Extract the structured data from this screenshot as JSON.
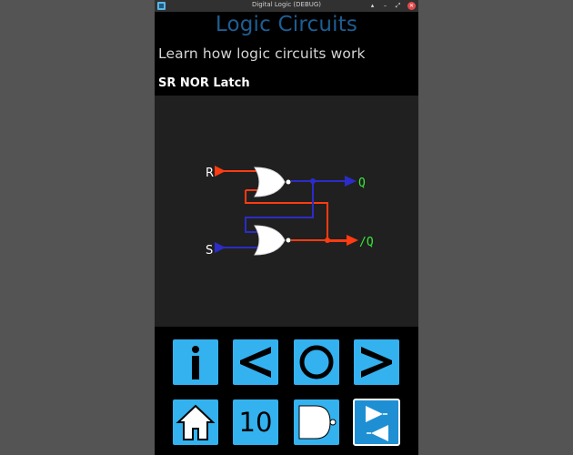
{
  "window": {
    "title": "Digital Logic (DEBUG)"
  },
  "app": {
    "title": "Logic Circuits",
    "subtitle": "Learn how logic circuits work",
    "circuit_name": "SR  NOR Latch"
  },
  "circuit": {
    "input_r": "R",
    "input_s": "S",
    "output_q": "Q",
    "output_qbar": "/Q"
  },
  "buttons": {
    "info": "i",
    "number": "10",
    "info_icon": "info-icon",
    "prev_icon": "chevron-left-icon",
    "play_icon": "circle-icon",
    "next_icon": "chevron-right-icon",
    "home_icon": "home-icon",
    "gate_icon": "nand-gate-icon",
    "flip_icon": "flip-gate-icon"
  },
  "colors": {
    "accent": "#33b2ef",
    "title": "#1c5e93",
    "wire_high": "#ff3b12",
    "wire_low": "#2c2cc8",
    "output_text": "#39e639"
  }
}
